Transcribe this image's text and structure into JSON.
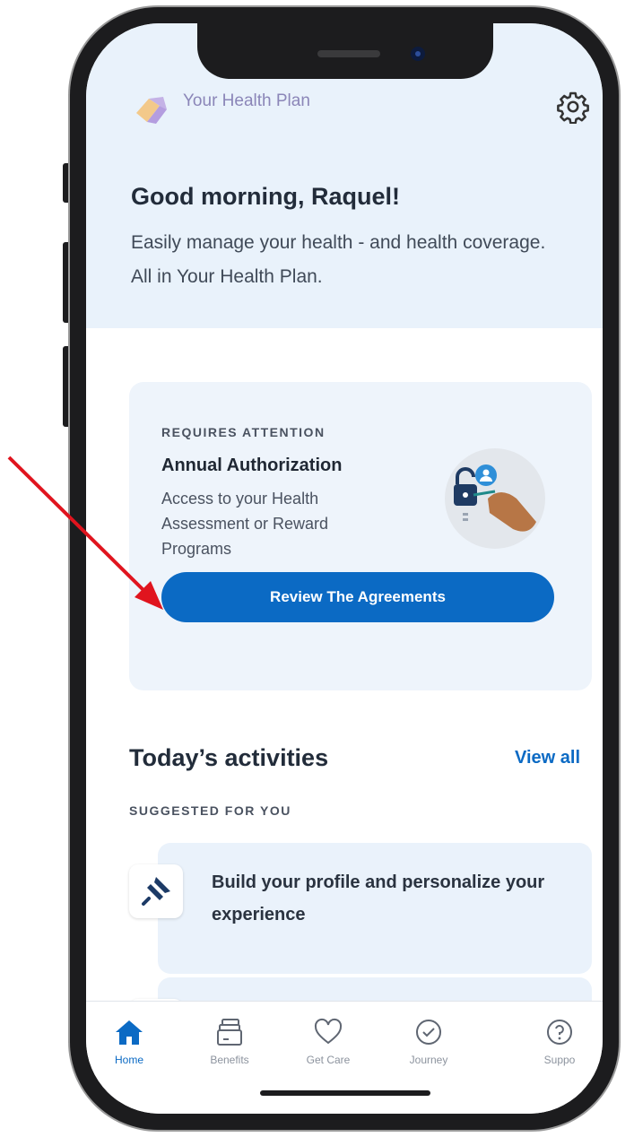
{
  "header": {
    "app_title": "Your Health Plan",
    "logo_icon": "plan-logo-icon",
    "settings_icon": "gear-icon"
  },
  "hero": {
    "greeting": "Good morning, Raquel!",
    "subtext": "Easily manage your health - and health coverage. All in Your Health Plan."
  },
  "attention_card": {
    "eyebrow": "REQUIRES ATTENTION",
    "title": "Annual Authorization",
    "body": "Access to your Health Assessment or Reward Programs",
    "button_label": "Review The Agreements",
    "illustration": "lock-and-hand-illustration"
  },
  "activities": {
    "title": "Today’s activities",
    "view_all": "View all",
    "eyebrow": "SUGGESTED FOR YOU",
    "items": [
      {
        "text": "Build your profile and personalize your experience",
        "icon": "pin-icon"
      },
      {
        "text": "",
        "icon": "pin-icon"
      }
    ]
  },
  "tabbar": {
    "items": [
      {
        "label": "Home",
        "icon": "home-icon",
        "active": true
      },
      {
        "label": "Benefits",
        "icon": "wallet-icon",
        "active": false
      },
      {
        "label": "Get Care",
        "icon": "heart-icon",
        "active": false
      },
      {
        "label": "Journey",
        "icon": "check-circle-icon",
        "active": false
      },
      {
        "label": "Suppo",
        "icon": "help-circle-icon",
        "active": false
      }
    ]
  },
  "colors": {
    "primary": "#0b6ac4",
    "hero_bg": "#e9f2fb",
    "card_bg": "#eef4fb",
    "annotation_arrow": "#e0141e"
  }
}
